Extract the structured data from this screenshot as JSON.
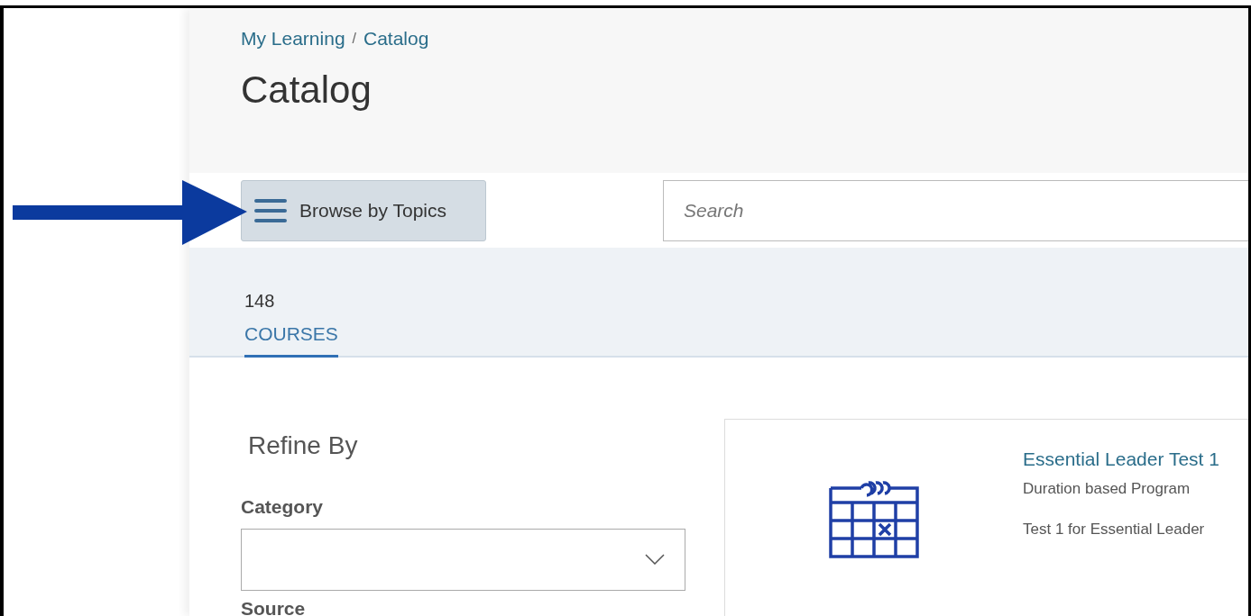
{
  "breadcrumb": [
    "My Learning",
    "Catalog"
  ],
  "breadcrumb_separator": "/",
  "page_title": "Catalog",
  "browse_button": {
    "label": "Browse by Topics"
  },
  "search": {
    "placeholder": "Search"
  },
  "tabs": [
    {
      "count": "148",
      "label": "COURSES",
      "selected": true
    }
  ],
  "refine": {
    "title": "Refine By",
    "filters": [
      {
        "label": "Category",
        "kind": "select"
      },
      {
        "label": "Source",
        "kind": "label"
      }
    ]
  },
  "results": [
    {
      "title": "Essential Leader Test 1",
      "type": "Duration based Program",
      "description": "Test 1 for Essential Leader"
    }
  ]
}
